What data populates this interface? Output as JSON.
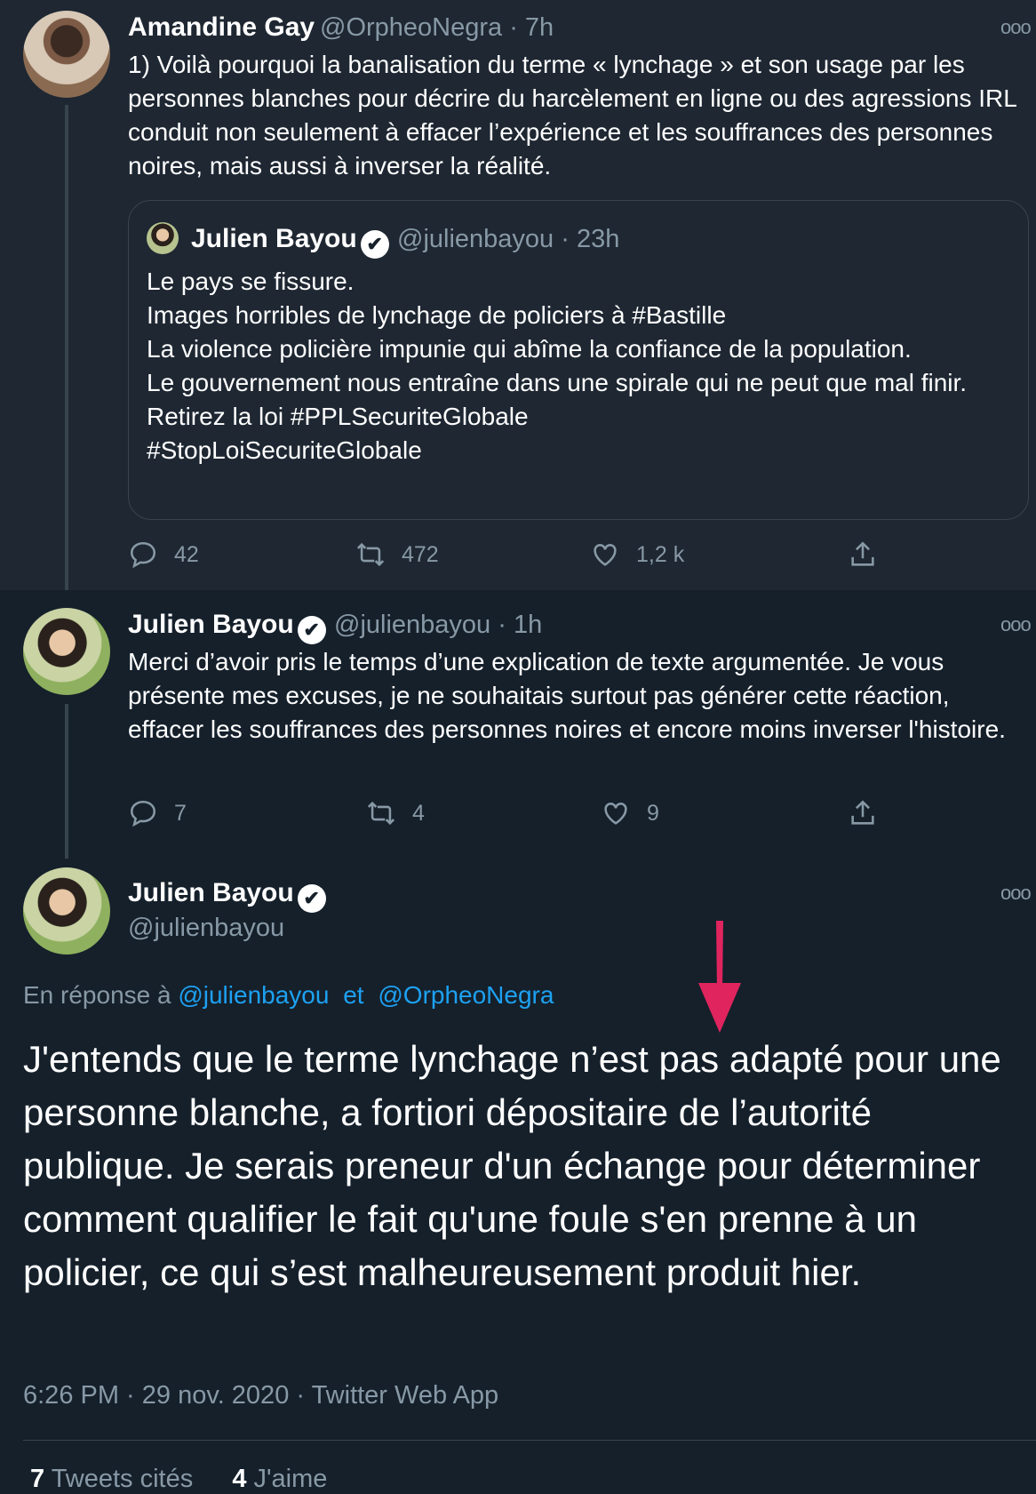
{
  "tweet1": {
    "name": "Amandine Gay",
    "handle": "@OrpheoNegra · 7h",
    "text": "1) Voilà pourquoi la banalisation du terme « lynchage » et son usage par les personnes blanches pour décrire du harcèlement en ligne ou des agressions IRL conduit non seulement à effacer l’expérience et les souffrances des personnes noires, mais aussi à inverser la réalité.",
    "quote": {
      "name": "Julien Bayou",
      "handle": "@julienbayou · 23h",
      "text": "Le pays se fissure.\nImages horribles de lynchage de policiers à #Bastille\nLa violence policière impunie qui abîme la confiance de la population.\nLe gouvernement nous entraîne dans une spirale qui ne peut que mal finir.\nRetirez la loi #PPLSecuriteGlobale\n#StopLoiSecuriteGlobale"
    },
    "replies": "42",
    "retweets": "472",
    "likes": "1,2 k"
  },
  "tweet2": {
    "name": "Julien Bayou",
    "handle": "@julienbayou · 1h",
    "text": "Merci d’avoir pris le temps d’une explication de texte argumentée. Je vous présente mes excuses, je ne souhaitais surtout pas générer cette réaction, effacer les souffrances des personnes noires et encore moins inverser l'histoire.",
    "replies": "7",
    "retweets": "4",
    "likes": "9"
  },
  "tweet3": {
    "name": "Julien Bayou",
    "handle": "@julienbayou",
    "reply_prefix": "En réponse à ",
    "reply_user1": "@julienbayou",
    "reply_and": "et",
    "reply_user2": "@OrpheoNegra",
    "text": "J'entends que le terme lynchage n’est pas adapté pour une personne blanche, a fortiori dépositaire de l’autorité publique. Je serais preneur d'un échange pour déterminer comment qualifier le fait qu'une foule s'en prenne à un policier, ce qui s’est malheureusement produit hier.",
    "meta": "6:26 PM · 29 nov. 2020 · Twitter Web App",
    "quoted_count": "7",
    "quoted_label": "Tweets cités",
    "likes_count": "4",
    "likes_label": "J'aime"
  },
  "more_glyph": "ooo",
  "verified_glyph": "✔",
  "colors": {
    "background": "#15202b",
    "highlight_background": "#1e2732",
    "secondary_text": "#8899a6",
    "link": "#1da1f2",
    "arrow": "#e0245e"
  }
}
